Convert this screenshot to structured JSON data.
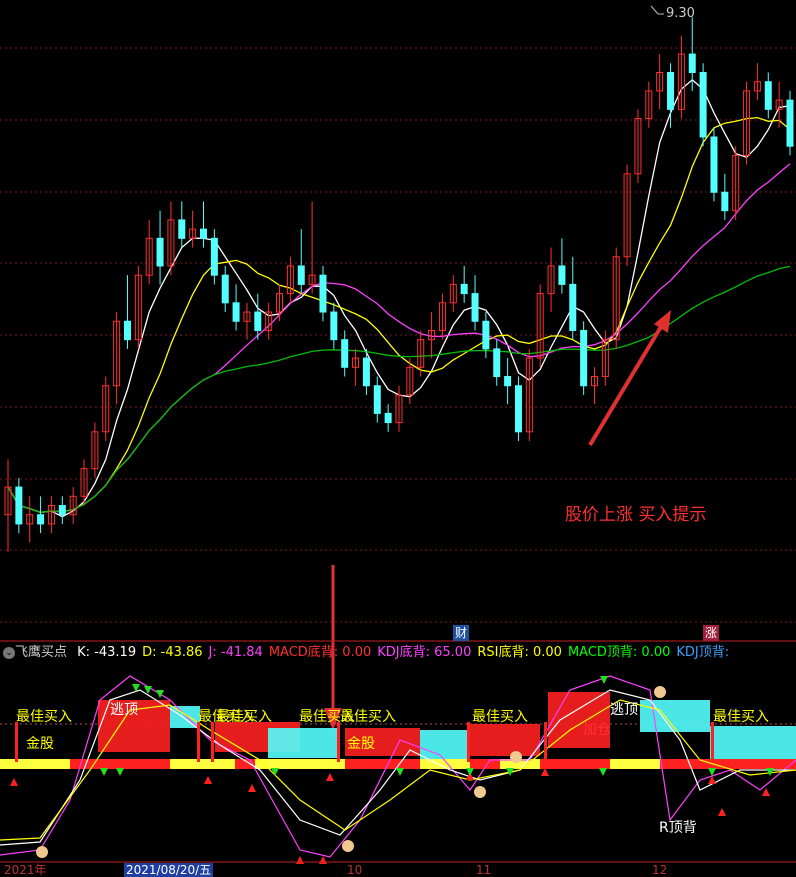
{
  "price_panel": {
    "high_label": "9.30",
    "annotation": "股价上涨 买入提示",
    "badges": [
      "财",
      "涨"
    ]
  },
  "indicator_bar": {
    "name": "飞鹰买点",
    "fields": [
      {
        "label": "K:",
        "value": "-43.19",
        "color": "#ffffff"
      },
      {
        "label": "D:",
        "value": "-43.86",
        "color": "#ffff00"
      },
      {
        "label": "J:",
        "value": "-41.84",
        "color": "#ff40ff"
      },
      {
        "label": "MACD底背:",
        "value": "0.00",
        "color": "#ff3030"
      },
      {
        "label": "KDJ底背:",
        "value": "65.00",
        "color": "#ff40ff"
      },
      {
        "label": "RSI底背:",
        "value": "0.00",
        "color": "#ffff00"
      },
      {
        "label": "MACD顶背:",
        "value": "0.00",
        "color": "#00ff00"
      },
      {
        "label": "KDJ顶背:",
        "value": "",
        "color": "#3ca0ff"
      }
    ]
  },
  "signals": {
    "best_buy": "最佳买入",
    "golden_stock": "金股",
    "escape_top": "逃顶",
    "add_position": "加仓",
    "r_top": "R顶背"
  },
  "time_axis": {
    "labels": [
      "2021年",
      "2021/08/20/五",
      "10",
      "11",
      "12"
    ]
  },
  "colors": {
    "up": "#ff3030",
    "down": "#54ffff",
    "ma_white": "#ffffff",
    "ma_yellow": "#ffff00",
    "ma_magenta": "#ff40ff",
    "ma_green": "#00c000"
  },
  "chart_data": {
    "type": "candlestick",
    "high_marker": 9.3,
    "candles": [
      [
        6.6,
        6.9,
        6.4,
        6.75
      ],
      [
        6.75,
        6.8,
        6.5,
        6.55
      ],
      [
        6.55,
        6.7,
        6.45,
        6.6
      ],
      [
        6.6,
        6.7,
        6.5,
        6.55
      ],
      [
        6.55,
        6.7,
        6.5,
        6.65
      ],
      [
        6.65,
        6.7,
        6.55,
        6.6
      ],
      [
        6.6,
        6.75,
        6.55,
        6.7
      ],
      [
        6.7,
        6.9,
        6.65,
        6.85
      ],
      [
        6.85,
        7.1,
        6.8,
        7.05
      ],
      [
        7.05,
        7.35,
        7.0,
        7.3
      ],
      [
        7.3,
        7.7,
        7.2,
        7.65
      ],
      [
        7.65,
        7.9,
        7.5,
        7.55
      ],
      [
        7.55,
        7.95,
        7.5,
        7.9
      ],
      [
        7.9,
        8.2,
        7.85,
        8.1
      ],
      [
        8.1,
        8.25,
        7.85,
        7.95
      ],
      [
        7.95,
        8.3,
        7.9,
        8.2
      ],
      [
        8.2,
        8.3,
        8.05,
        8.1
      ],
      [
        8.1,
        8.25,
        8.05,
        8.15
      ],
      [
        8.15,
        8.3,
        8.05,
        8.1
      ],
      [
        8.1,
        8.15,
        7.85,
        7.9
      ],
      [
        7.9,
        7.95,
        7.7,
        7.75
      ],
      [
        7.75,
        7.85,
        7.6,
        7.65
      ],
      [
        7.65,
        7.75,
        7.55,
        7.7
      ],
      [
        7.7,
        7.8,
        7.55,
        7.6
      ],
      [
        7.6,
        7.75,
        7.55,
        7.7
      ],
      [
        7.7,
        7.85,
        7.65,
        7.8
      ],
      [
        7.8,
        8.0,
        7.75,
        7.95
      ],
      [
        7.95,
        8.15,
        7.8,
        7.85
      ],
      [
        7.85,
        8.3,
        7.8,
        7.9
      ],
      [
        7.9,
        7.95,
        7.65,
        7.7
      ],
      [
        7.7,
        7.75,
        7.5,
        7.55
      ],
      [
        7.55,
        7.6,
        7.35,
        7.4
      ],
      [
        7.4,
        7.5,
        7.3,
        7.45
      ],
      [
        7.45,
        7.5,
        7.25,
        7.3
      ],
      [
        7.3,
        7.35,
        7.1,
        7.15
      ],
      [
        7.15,
        7.2,
        7.05,
        7.1
      ],
      [
        7.1,
        7.3,
        7.05,
        7.25
      ],
      [
        7.25,
        7.45,
        7.2,
        7.4
      ],
      [
        7.4,
        7.6,
        7.35,
        7.55
      ],
      [
        7.55,
        7.7,
        7.45,
        7.6
      ],
      [
        7.6,
        7.8,
        7.55,
        7.75
      ],
      [
        7.75,
        7.9,
        7.7,
        7.85
      ],
      [
        7.85,
        7.95,
        7.75,
        7.8
      ],
      [
        7.8,
        7.9,
        7.6,
        7.65
      ],
      [
        7.65,
        7.7,
        7.45,
        7.5
      ],
      [
        7.5,
        7.55,
        7.3,
        7.35
      ],
      [
        7.35,
        7.45,
        7.2,
        7.3
      ],
      [
        7.3,
        7.35,
        7.0,
        7.05
      ],
      [
        7.05,
        7.5,
        7.0,
        7.45
      ],
      [
        7.45,
        7.85,
        7.4,
        7.8
      ],
      [
        7.8,
        8.05,
        7.7,
        7.95
      ],
      [
        7.95,
        8.1,
        7.8,
        7.85
      ],
      [
        7.85,
        8.0,
        7.55,
        7.6
      ],
      [
        7.6,
        7.65,
        7.25,
        7.3
      ],
      [
        7.3,
        7.4,
        7.2,
        7.35
      ],
      [
        7.35,
        7.6,
        7.3,
        7.55
      ],
      [
        7.55,
        8.05,
        7.5,
        8.0
      ],
      [
        8.0,
        8.5,
        7.95,
        8.45
      ],
      [
        8.45,
        8.8,
        8.4,
        8.75
      ],
      [
        8.75,
        8.95,
        8.7,
        8.9
      ],
      [
        8.9,
        9.1,
        8.8,
        9.0
      ],
      [
        9.0,
        9.05,
        8.7,
        8.8
      ],
      [
        8.8,
        9.2,
        8.75,
        9.1
      ],
      [
        9.1,
        9.3,
        8.9,
        9.0
      ],
      [
        9.0,
        9.05,
        8.6,
        8.65
      ],
      [
        8.65,
        8.7,
        8.3,
        8.35
      ],
      [
        8.35,
        8.45,
        8.2,
        8.25
      ],
      [
        8.25,
        8.6,
        8.2,
        8.55
      ],
      [
        8.55,
        8.95,
        8.5,
        8.9
      ],
      [
        8.9,
        9.05,
        8.85,
        8.95
      ],
      [
        8.95,
        9.0,
        8.75,
        8.8
      ],
      [
        8.8,
        8.95,
        8.7,
        8.85
      ],
      [
        8.85,
        8.9,
        8.55,
        8.6
      ]
    ]
  }
}
